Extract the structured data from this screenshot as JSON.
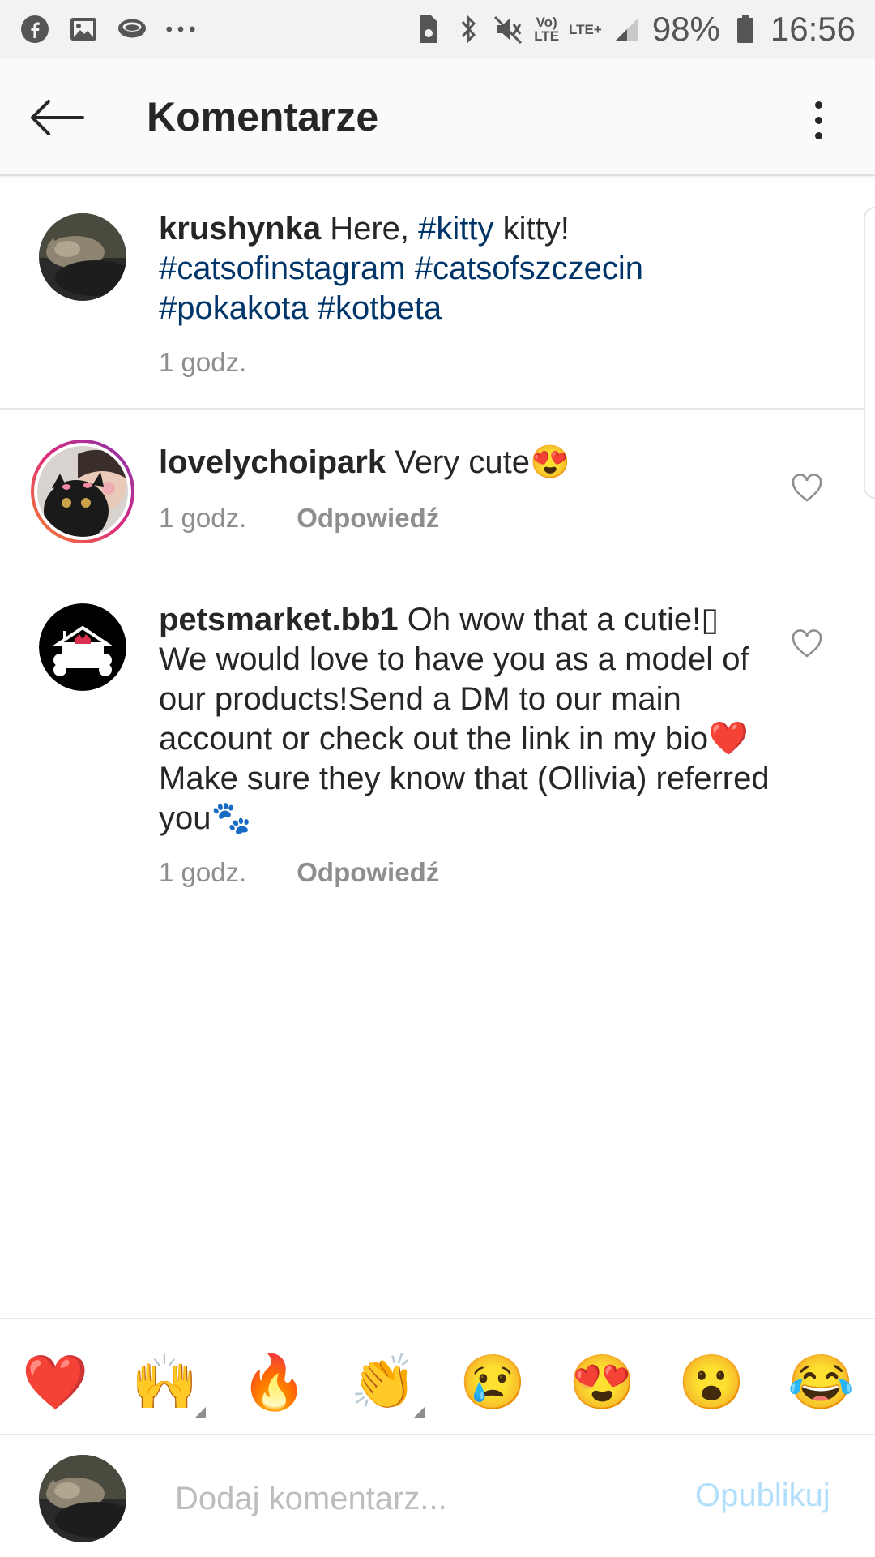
{
  "status_bar": {
    "left_icons": [
      "facebook-icon",
      "gallery-icon",
      "messenger-icon",
      "more-dots-icon"
    ],
    "vo_top": "Vo)",
    "vo_bottom": "LTE",
    "lte": "LTE+",
    "battery": "98%",
    "time": "16:56"
  },
  "header": {
    "title": "Komentarze",
    "back_icon": "back-arrow-icon",
    "more_icon": "more-vertical-icon"
  },
  "caption": {
    "username": "krushynka",
    "text": " Here, ",
    "tag1": "#kitty",
    "text2": " kitty!",
    "tags_line2": "#catsofinstagram #catsofszczecin",
    "tags_line3": "#pokakota #kotbeta",
    "time": "1 godz."
  },
  "comments": [
    {
      "username": "lovelychoipark",
      "text": " Very cute😍",
      "time": "1 godz.",
      "reply": "Odpowiedź"
    },
    {
      "username": "petsmarket.bb1",
      "text": " Oh wow that a cutie!▯ We would love to have you as a model of our products!Send a DM to our main account or check out the link in my bio❤️Make sure they know that (Ollivia) referred you🐾",
      "time": "1 godz.",
      "reply": "Odpowiedź"
    }
  ],
  "emoji_bar": [
    "❤️",
    "🙌",
    "🔥",
    "👏",
    "😢",
    "😍",
    "😮",
    "😂"
  ],
  "composer": {
    "placeholder": "Dodaj komentarz...",
    "publish": "Opublikuj"
  },
  "colors": {
    "hashtag": "#003569",
    "meta_gray": "#8e8e8e",
    "publish_disabled": "#b2dffc",
    "story_ring": [
      "#f58529",
      "#dd2a7b",
      "#8134af"
    ]
  }
}
